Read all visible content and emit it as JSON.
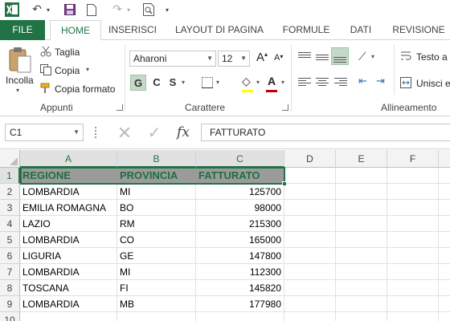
{
  "qat": {
    "icons": [
      "excel-logo-icon",
      "undo-icon",
      "save-icon",
      "new-file-icon",
      "redo-icon",
      "print-preview-icon",
      "customize-qat-icon"
    ]
  },
  "tabs": [
    {
      "label": "FILE"
    },
    {
      "label": "HOME"
    },
    {
      "label": "INSERISCI"
    },
    {
      "label": "LAYOUT DI PAGINA"
    },
    {
      "label": "FORMULE"
    },
    {
      "label": "DATI"
    },
    {
      "label": "REVISIONE"
    }
  ],
  "ribbon": {
    "clipboard": {
      "paste_label": "Incolla",
      "cut_label": "Taglia",
      "copy_label": "Copia",
      "format_painter_label": "Copia formato",
      "group_label": "Appunti"
    },
    "font": {
      "font_name": "Aharoni",
      "font_size": "12",
      "grow_label": "A",
      "shrink_label": "A",
      "bold_label": "G",
      "italic_label": "C",
      "underline_label": "S",
      "fill_label": "◇",
      "color_label": "A",
      "group_label": "Carattere"
    },
    "alignment": {
      "wrap_label": "Testo a",
      "merge_label": "Unisci e",
      "group_label": "Allineamento"
    }
  },
  "formula_bar": {
    "name_box": "C1",
    "fx_label": "fx",
    "content": "FATTURATO"
  },
  "sheet": {
    "columns": [
      "A",
      "B",
      "C",
      "D",
      "E",
      "F"
    ],
    "rows": [
      "1",
      "2",
      "3",
      "4",
      "5",
      "6",
      "7",
      "8",
      "9",
      "10"
    ],
    "header": [
      "REGIONE",
      "PROVINCIA",
      "FATTURATO"
    ],
    "data": [
      [
        "LOMBARDIA",
        "MI",
        "125700"
      ],
      [
        "EMILIA ROMAGNA",
        "BO",
        "98000"
      ],
      [
        "LAZIO",
        "RM",
        "215300"
      ],
      [
        "LOMBARDIA",
        "CO",
        "165000"
      ],
      [
        "LIGURIA",
        "GE",
        "147800"
      ],
      [
        "LOMBARDIA",
        "MI",
        "112300"
      ],
      [
        "TOSCANA",
        "FI",
        "145820"
      ],
      [
        "LOMBARDIA",
        "MB",
        "177980"
      ]
    ]
  },
  "colors": {
    "accent": "#217346",
    "header_fill": "#9b9b9b",
    "header_text": "#1f6f3c"
  }
}
